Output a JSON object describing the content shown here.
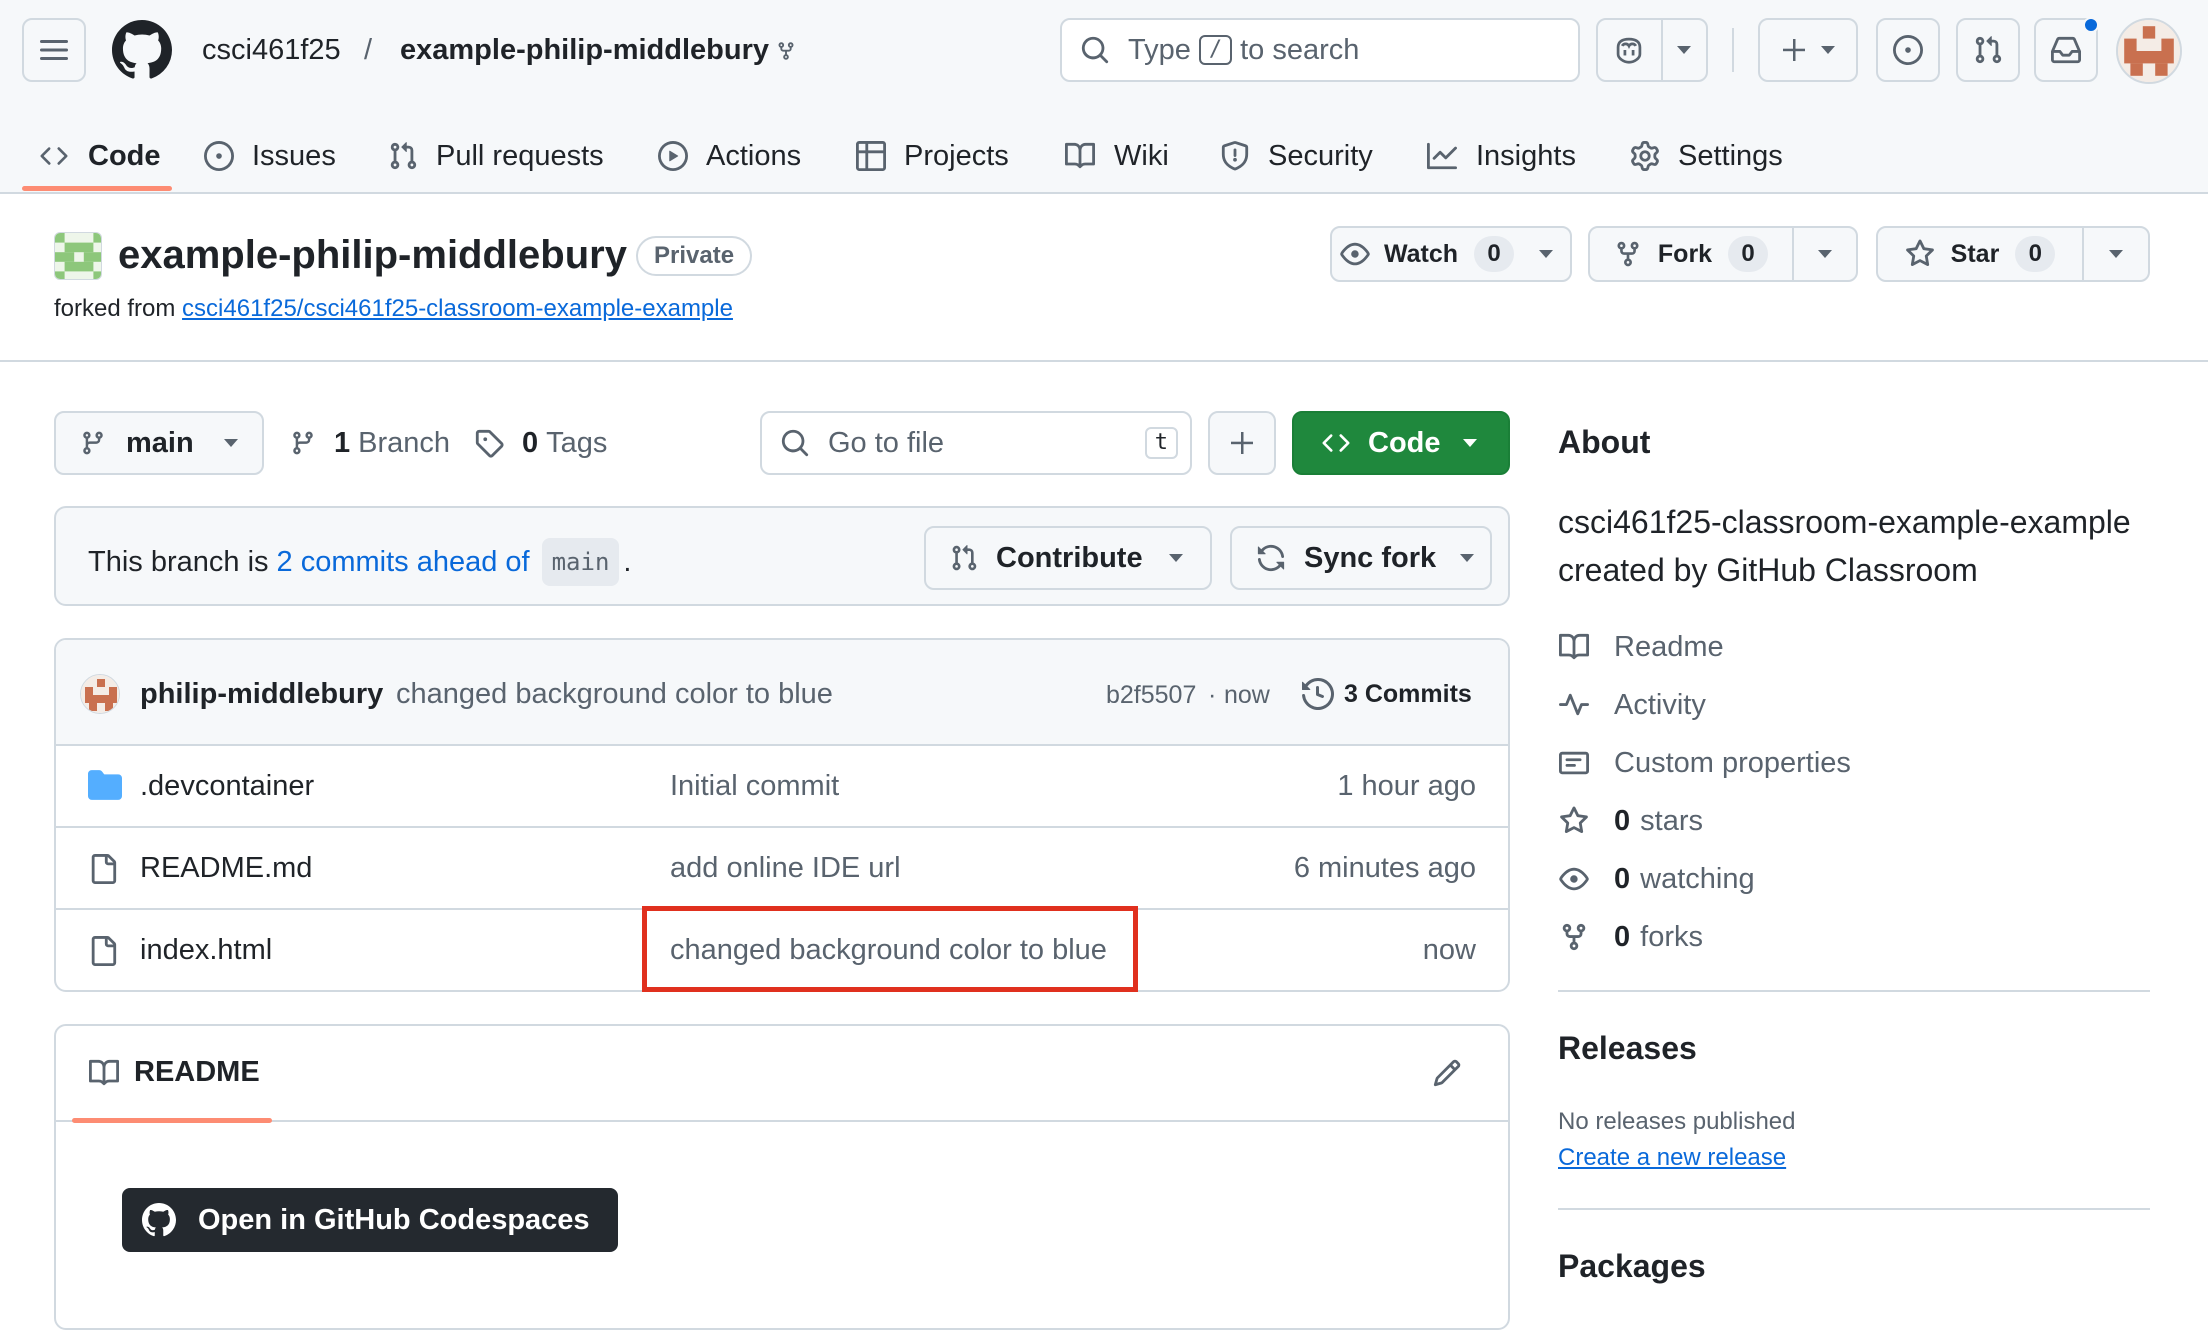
{
  "header": {
    "owner": "csci461f25",
    "separator": "/",
    "repo": "example-philip-middlebury",
    "search_prefix": "Type",
    "search_key": "/",
    "search_suffix": "to search"
  },
  "tabs": [
    {
      "label": "Code",
      "icon": "code-icon",
      "active": true
    },
    {
      "label": "Issues",
      "icon": "issue-icon"
    },
    {
      "label": "Pull requests",
      "icon": "pull-request-icon"
    },
    {
      "label": "Actions",
      "icon": "play-icon"
    },
    {
      "label": "Projects",
      "icon": "table-icon"
    },
    {
      "label": "Wiki",
      "icon": "book-icon"
    },
    {
      "label": "Security",
      "icon": "shield-icon"
    },
    {
      "label": "Insights",
      "icon": "graph-icon"
    },
    {
      "label": "Settings",
      "icon": "gear-icon"
    }
  ],
  "repo": {
    "title": "example-philip-middlebury",
    "visibility": "Private",
    "forked_prefix": "forked from",
    "forked_link": "csci461f25/csci461f25-classroom-example-example",
    "watch_label": "Watch",
    "watch_count": "0",
    "fork_label": "Fork",
    "fork_count": "0",
    "star_label": "Star",
    "star_count": "0"
  },
  "toolbar": {
    "branch": "main",
    "branches_count": "1",
    "branches_label": "Branch",
    "tags_count": "0",
    "tags_label": "Tags",
    "goto_placeholder": "Go to file",
    "goto_key": "t",
    "code_label": "Code"
  },
  "ahead": {
    "prefix": "This branch is",
    "link": "2 commits ahead of",
    "branch": "main",
    "suffix": ".",
    "contribute": "Contribute",
    "sync": "Sync fork"
  },
  "latest_commit": {
    "author": "philip-middlebury",
    "message": "changed background color to blue",
    "hash": "b2f5507",
    "dot": "·",
    "time": "now",
    "commits": "3 Commits"
  },
  "files": [
    {
      "name": ".devcontainer",
      "type": "folder",
      "message": "Initial commit",
      "time": "1 hour ago"
    },
    {
      "name": "README.md",
      "type": "file",
      "message": "add online IDE url",
      "time": "6 minutes ago"
    },
    {
      "name": "index.html",
      "type": "file",
      "message": "changed background color to blue",
      "time": "now"
    }
  ],
  "readme": {
    "title": "README",
    "codespaces": "Open in GitHub Codespaces"
  },
  "about": {
    "heading": "About",
    "description": "csci461f25-classroom-example-example created by GitHub Classroom",
    "readme": "Readme",
    "activity": "Activity",
    "custom_properties": "Custom properties",
    "stars_count": "0",
    "stars_label": "stars",
    "watching_count": "0",
    "watching_label": "watching",
    "forks_count": "0",
    "forks_label": "forks"
  },
  "releases": {
    "heading": "Releases",
    "none": "No releases published",
    "create": "Create a new release"
  },
  "packages": {
    "heading": "Packages"
  },
  "colors": {
    "accent_green": "#1f883d",
    "link_blue": "#0969da",
    "tab_underline": "#fd8c73",
    "highlight_red": "#e0301e"
  }
}
